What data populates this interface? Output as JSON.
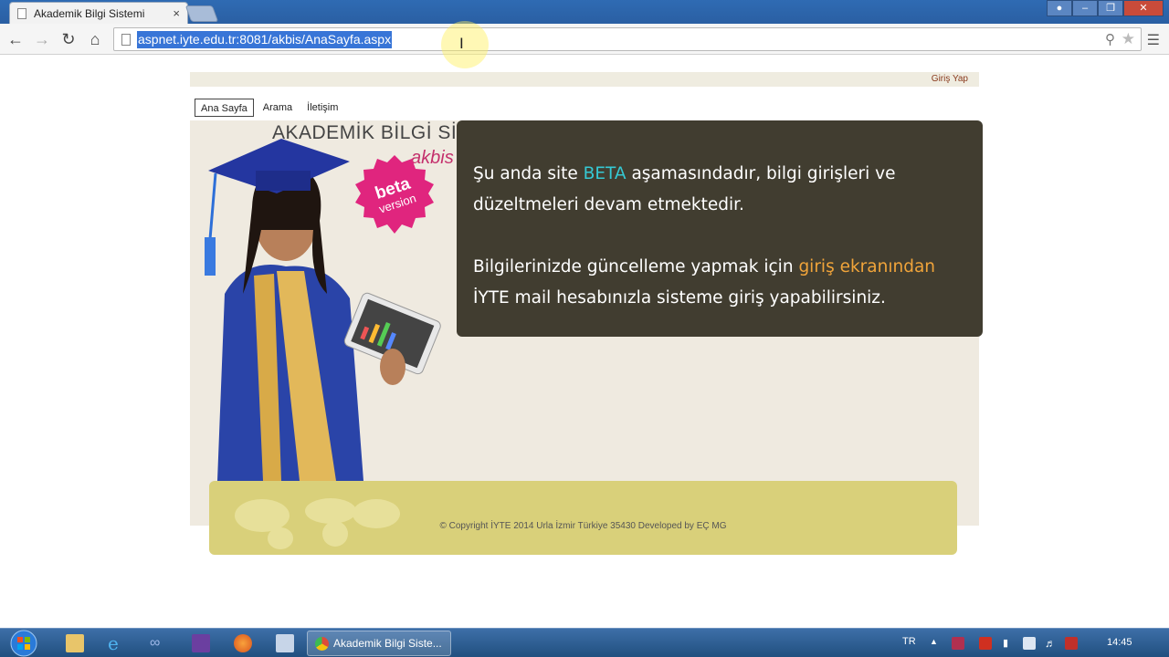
{
  "browser": {
    "tab_title": "Akademik Bilgi Sistemi",
    "tab_close": "×",
    "url": "aspnet.iyte.edu.tr:8081/akbis/AnaSayfa.aspx"
  },
  "page": {
    "login_link": "Giriş Yap",
    "nav": [
      "Ana Sayfa",
      "Arama",
      "İletişim"
    ],
    "brand_title": "AKADEMİK BİLGİ SİSTEMİ",
    "brand_sub": "akbis",
    "badge": "beta version",
    "info": {
      "p1_before": "Şu anda site ",
      "p1_highlight": "BETA",
      "p1_after": " aşamasındadır, bilgi girişleri ve düzeltmeleri devam etmektedir.",
      "p2_before": "Bilgilerinizde güncelleme yapmak için ",
      "p2_highlight": "giriş ekranından",
      "p2_after": " İYTE mail hesabınızla sisteme giriş yapabilirsiniz."
    },
    "footer": "© Copyright İYTE 2014 Urla İzmir Türkiye 35430 Developed by EÇ MG"
  },
  "taskbar": {
    "active_app": "Akademik Bilgi Siste...",
    "lang": "TR",
    "time": "14:45"
  },
  "colors": {
    "info_bg": "#413d30",
    "highlight_cyan": "#35c9d4",
    "highlight_orange": "#f0a43a",
    "footer_bg": "#d9d07a",
    "selection": "#3875d7"
  }
}
